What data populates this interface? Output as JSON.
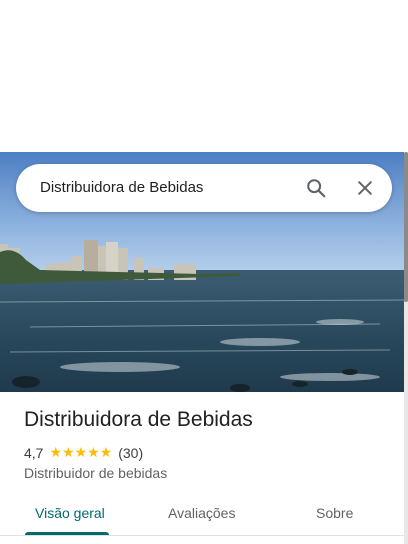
{
  "search": {
    "query": "Distribuidora de Bebidas"
  },
  "icons": {
    "search": "search-icon",
    "close": "close-icon"
  },
  "place": {
    "name": "Distribuidora de Bebidas",
    "rating": "4,7",
    "stars": 4.7,
    "review_count": "(30)",
    "category": "Distribuidor de bebidas"
  },
  "tabs": [
    {
      "label": "Visão geral",
      "active": true
    },
    {
      "label": "Avaliações",
      "active": false
    },
    {
      "label": "Sobre",
      "active": false
    }
  ],
  "colors": {
    "accent": "#01696f",
    "star": "#fbbc04"
  }
}
